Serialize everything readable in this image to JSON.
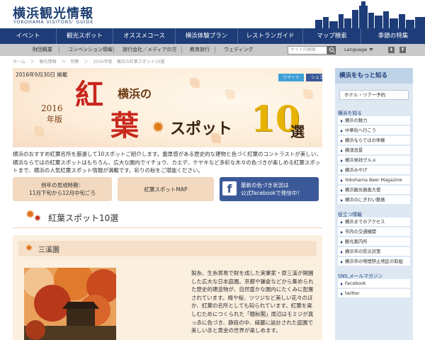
{
  "header": {
    "logo_jp": "横浜観光情報",
    "logo_en": "YOKOHAMA VISITORS' GUIDE"
  },
  "main_nav": [
    "イベント",
    "観光スポット",
    "オススメコース",
    "横浜体験プラン",
    "レストランガイド",
    "マップ検索",
    "季節の特集"
  ],
  "sub_nav": {
    "items": [
      "財団概要",
      "コンベンション情報",
      "旅行会社／メディアの方",
      "教育旅行",
      "ウェディング"
    ],
    "search_placeholder": "サイト内検索",
    "language": "Language",
    "icons": [
      "twitter-icon",
      "facebook-icon"
    ]
  },
  "breadcrumb": [
    "ホーム",
    "＞",
    "観光情報",
    "＞",
    "特集",
    "＞",
    "2016年版　横浜の紅葉スポット10選"
  ],
  "hero": {
    "date": "2016年9月30日 掲載",
    "share_tweet": "ツイート",
    "share_fb": "シェア",
    "year": "2016",
    "edition": "年版",
    "beni": "紅",
    "yokohama": "横浜の",
    "ha": "葉",
    "spot": "スポット",
    "ten": "10",
    "sen": "選"
  },
  "intro": "横浜のおすすめ紅葉名所を厳選して10スポットご紹介します。重厚感がある歴史的な建物と色づく紅葉のコントラストが美しい、横浜ならではの紅葉スポットはもちろん、広大な園内でイチョウ、カエデ、ケヤキなど多彩な木々の色づきが楽しめる紅葉スポットまで、横浜の人気紅葉スポット情報が満載です。彩りの秋をご堪能ください。",
  "info_buttons": {
    "peak_line1": "例年の見頃時期：",
    "peak_line2": "11月下旬から12月中旬ごろ",
    "map": "紅葉スポットMAP",
    "fb_line1": "最新の色づき状況は",
    "fb_line2": "公式facebookで発信中！"
  },
  "section_title": "紅葉スポット10選",
  "card": {
    "title": "三溪園",
    "text": "製糸、生糸貿易で財を成した実業家・原三溪が開園した広大な日本庭園。京都や鎌倉などから集められた歴史的建造物が、自然豊かな園内にたくみに配置されています。梅や桜、ツツジなど美しい花々のほか、紅葉の名所としても知られています。紅葉を楽しむためにつくられた「聴秋閣」周辺はモミジが真っ赤に色づき、静寂の中、綺麗に設計された庭園で美しい赤と黄金の世界が楽しめます。"
  },
  "sidebar": {
    "title": "横浜をもっと知る",
    "pill": "ホテル・ツアー予約",
    "cat1": "横浜を知る",
    "links1": [
      "横浜の魅力",
      "中華街へ行こう",
      "横浜ならではの体験",
      "横濱良景",
      "横浜発祥グルメ",
      "横浜みやげ",
      "Yokohama Beer Magazine",
      "横浜観光親善大使",
      "横浜のにぎわい動画"
    ],
    "cat2": "役立つ情報",
    "links2": [
      "横浜までのアクセス",
      "市内の交通機関",
      "観光案内所",
      "横浜市の防災対策",
      "横浜市の喫煙禁止地区の取組"
    ],
    "cat3": "SNS,メールマガジン",
    "links3": [
      "Facebook",
      "twitter"
    ]
  },
  "colors": {
    "nav": "#1d3c78",
    "subnav": "#c9c9c9",
    "accent_red": "#c9271d",
    "accent_gold": "#e6b400",
    "facebook": "#3b5998",
    "twitter": "#3fa0d8",
    "sidebar_bg": "#dde8f3"
  }
}
